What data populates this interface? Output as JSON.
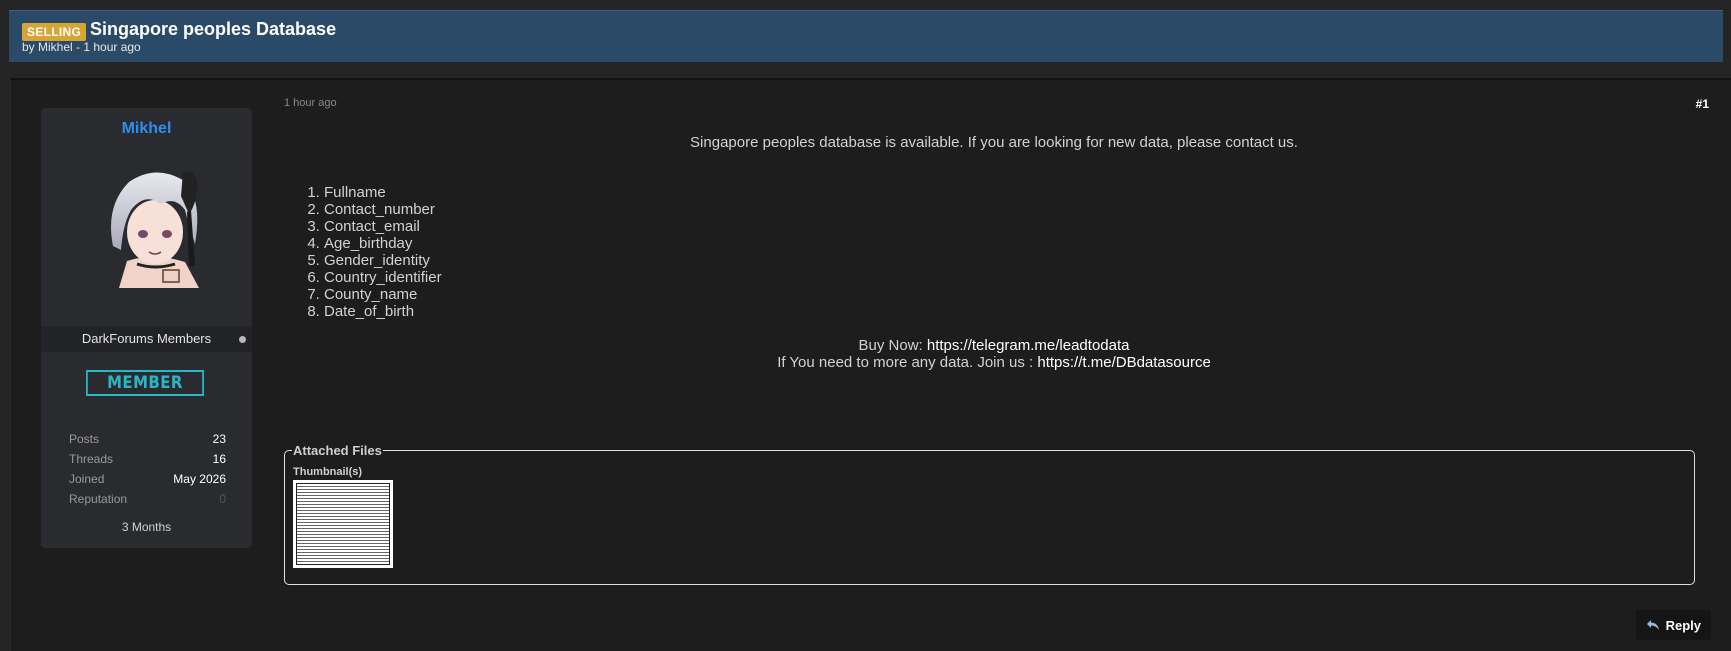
{
  "thread": {
    "prefix": "SELLING",
    "title": "Singapore peoples Database",
    "meta": "by Mikhel - 1 hour ago"
  },
  "author": {
    "name": "Mikhel",
    "group": "DarkForums Members",
    "rank": "MEMBER",
    "stats": [
      {
        "label": "Posts",
        "value": "23"
      },
      {
        "label": "Threads",
        "value": "16"
      },
      {
        "label": "Joined",
        "value": "May 2026"
      },
      {
        "label": "Reputation",
        "value": "0"
      }
    ],
    "tenure": "3 Months",
    "avatar_icon": "avatar-anime-character"
  },
  "post": {
    "time": "1 hour ago",
    "number": "#1",
    "intro": "Singapore peoples database is available. If you are looking for new data, please contact us.",
    "fields": [
      "Fullname",
      "Contact_number",
      "Contact_email",
      "Age_birthday",
      "Gender_identity",
      "Country_identifier",
      "County_name",
      "Date_of_birth"
    ],
    "buy_label": "Buy Now: ",
    "buy_link": "https://telegram.me/leadtodata",
    "join_label": "If You need to more any data. Join us  : ",
    "join_link": "https://t.me/DBdatasource"
  },
  "attachments": {
    "legend": "Attached Files",
    "thumbs_label": "Thumbnail(s)"
  },
  "actions": {
    "reply_label": "Reply",
    "reply_icon": "reply-arrow-icon"
  },
  "colors": {
    "header_bg": "#2a4a68",
    "prefix_bg": "#d6a534",
    "username": "#2c8ff0",
    "rank_accent": "#27b8c7"
  }
}
